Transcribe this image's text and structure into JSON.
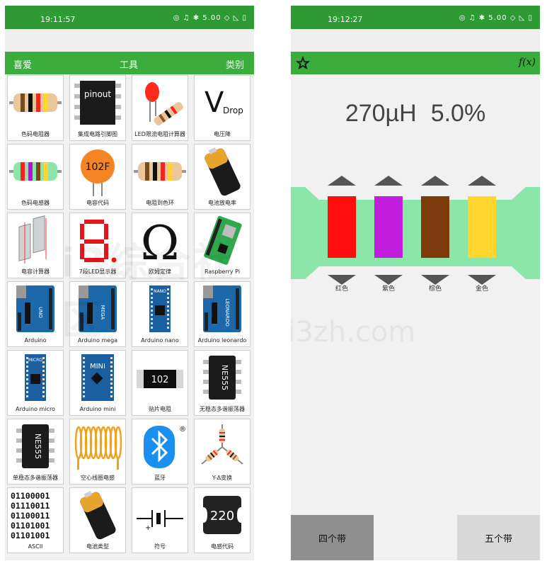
{
  "left": {
    "status_time": "19:11:57",
    "status_icons": "◎ ♫ ✱ 5.00 ◇ ◺ ▯",
    "tabs": [
      "喜爱",
      "工具",
      "类别"
    ],
    "tiles": [
      {
        "label": "色码电阻器",
        "icon": "resistor-icon"
      },
      {
        "label": "集成电路引脚图",
        "icon": "ic-pinout-icon",
        "text": "pinout"
      },
      {
        "label": "LED限流电阻计算器",
        "icon": "led-icon"
      },
      {
        "label": "电压降",
        "icon": "voltage-drop-icon",
        "text": "V",
        "sub": "Drop"
      },
      {
        "label": "色码电感器",
        "icon": "inductor-icon"
      },
      {
        "label": "电容代码",
        "icon": "capacitor-icon",
        "text": "102F"
      },
      {
        "label": "电阻到色环",
        "icon": "resistor-to-color-icon"
      },
      {
        "label": "电池放电率",
        "icon": "battery-icon"
      },
      {
        "label": "电容计算器",
        "icon": "capacitor-calc-icon"
      },
      {
        "label": "7段LED显示器",
        "icon": "seven-segment-icon"
      },
      {
        "label": "欧姆定律",
        "icon": "ohm-icon",
        "text": "Ω"
      },
      {
        "label": "Raspberry Pi",
        "icon": "raspberry-pi-icon"
      },
      {
        "label": "Arduino",
        "icon": "arduino-uno-icon",
        "text": "UNO"
      },
      {
        "label": "Arduino mega",
        "icon": "arduino-mega-icon",
        "text": "MEGA"
      },
      {
        "label": "Arduino nano",
        "icon": "arduino-nano-icon",
        "text": "NANO"
      },
      {
        "label": "Arduino leonardo",
        "icon": "arduino-leonardo-icon",
        "text": "LEONARDO"
      },
      {
        "label": "Arduino micro",
        "icon": "arduino-micro-icon",
        "text": "MICRO"
      },
      {
        "label": "Arduino mini",
        "icon": "arduino-mini-icon",
        "text": "MINI"
      },
      {
        "label": "贴片电阻",
        "icon": "smd-resistor-icon",
        "text": "102"
      },
      {
        "label": "无稳态多谐振荡器",
        "icon": "ne555-astable-icon",
        "text": "NE555"
      },
      {
        "label": "单稳态多谐振荡器",
        "icon": "ne555-monostable-icon",
        "text": "NE555"
      },
      {
        "label": "空心线圈电感",
        "icon": "air-coil-icon"
      },
      {
        "label": "蓝牙",
        "icon": "bluetooth-icon",
        "text": "®"
      },
      {
        "label": "Y-Δ变换",
        "icon": "y-delta-icon"
      },
      {
        "label": "ASCII",
        "icon": "ascii-icon",
        "lines": [
          "01100001",
          "01110011",
          "01100011",
          "01101001",
          "01101001"
        ]
      },
      {
        "label": "电池类型",
        "icon": "battery-types-icon"
      },
      {
        "label": "符号",
        "icon": "symbol-icon"
      },
      {
        "label": "电感代码",
        "icon": "inductor-code-icon",
        "text": "220"
      }
    ],
    "watermark": "i3综合社区",
    "watermark2": "www.i3zh.com"
  },
  "right": {
    "status_time": "19:12:27",
    "status_icons": "◎ ♫ ✱ 5.00 ◇ ◺ ▯",
    "fx_label": "f(x)",
    "value": "270µH",
    "tolerance": "5.0%",
    "bands": [
      {
        "name": "红色",
        "color": "#ff0d0d"
      },
      {
        "name": "紫色",
        "color": "#c21cde"
      },
      {
        "name": "棕色",
        "color": "#7b3b0c"
      },
      {
        "name": "金色",
        "color": "#ffd52e"
      }
    ],
    "body_color": "#8ce6a9",
    "accent": "#3aad3c",
    "buttons": [
      "四个带",
      "五个带"
    ]
  }
}
